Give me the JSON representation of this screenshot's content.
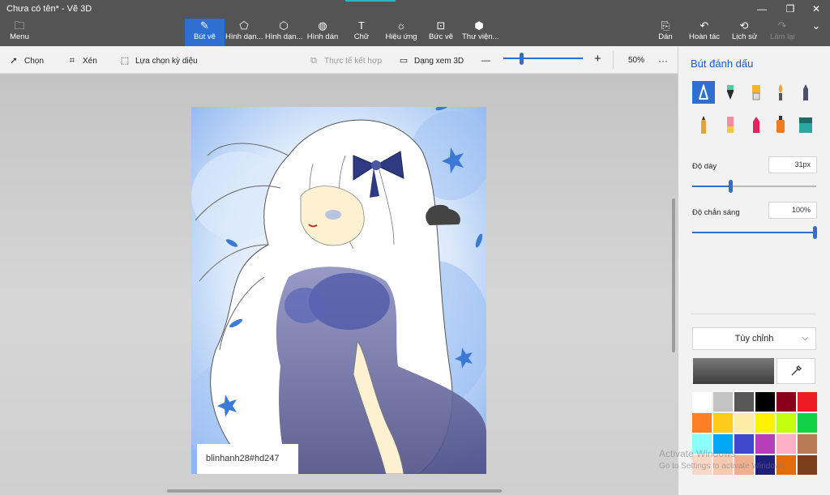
{
  "window": {
    "title": "Chưa có tên* - Vẽ 3D",
    "controls": [
      "—",
      "❐",
      "✕"
    ]
  },
  "ribbon": {
    "menu": "Menu",
    "tabs": [
      {
        "label": "Bút vẽ",
        "icon": "brush-icon",
        "glyph": "✎",
        "active": true
      },
      {
        "label": "Hình dạn...",
        "icon": "shapes-2d-icon",
        "glyph": "⬠",
        "active": false
      },
      {
        "label": "Hình dạn...",
        "icon": "shapes-3d-icon",
        "glyph": "⬡",
        "active": false
      },
      {
        "label": "Hình dán",
        "icon": "sticker-icon",
        "glyph": "◍",
        "active": false
      },
      {
        "label": "Chữ",
        "icon": "text-icon",
        "glyph": "T",
        "active": false
      },
      {
        "label": "Hiệu ứng",
        "icon": "effects-icon",
        "glyph": "☼",
        "active": false
      },
      {
        "label": "Bức vẽ",
        "icon": "canvas-icon",
        "glyph": "⊡",
        "active": false
      },
      {
        "label": "Thư viện...",
        "icon": "library-icon",
        "glyph": "⬢",
        "active": false
      }
    ],
    "right": [
      {
        "label": "Dán",
        "icon": "paste-icon",
        "glyph": "📋"
      },
      {
        "label": "Hoàn tác",
        "icon": "undo-icon",
        "glyph": "↶"
      },
      {
        "label": "Lịch sử",
        "icon": "history-icon",
        "glyph": "⟲"
      },
      {
        "label": "Làm lại",
        "icon": "redo-icon",
        "glyph": "↷"
      }
    ]
  },
  "toolbar": {
    "select": "Chọn",
    "crop": "Xén",
    "magic_select": "Lựa chọn kỳ diệu",
    "mixed_reality": "Thực tế kết hợp",
    "view_3d": "Dạng xem 3D",
    "zoom_out": "—",
    "zoom_in": "+",
    "zoom_percent": "50%",
    "zoom_level": 0.2,
    "more": "···"
  },
  "canvas": {
    "signature": "blinhanh28#hd247"
  },
  "panel": {
    "title": "Bút đánh dấu",
    "brushes": [
      "marker",
      "calligraphy-pen",
      "oil-brush",
      "watercolor",
      "pencil",
      "crayon",
      "eraser",
      "pixel-pen",
      "spray-can",
      "fill"
    ],
    "selected_brush": "marker",
    "thickness_label": "Độ dày",
    "thickness_value": "31px",
    "thickness_level": 0.31,
    "opacity_label": "Độ chắn sáng",
    "opacity_value": "100%",
    "opacity_level": 1.0,
    "finish_select": "Tùy chỉnh",
    "current_color": "#4a4a4a",
    "palette": [
      "#ffffff",
      "#c3c3c3",
      "#585858",
      "#000000",
      "#88001b",
      "#ec1c24",
      "#ff7f27",
      "#ffca18",
      "#fdeca6",
      "#fff200",
      "#c4ff0e",
      "#0ed145",
      "#8cfffb",
      "#00a8f3",
      "#3f48cc",
      "#b83dba",
      "#ffaec8",
      "#b97a56",
      "#f9d8c8",
      "#f6c9b1",
      "#f0b08f",
      "#1f1f7a",
      "#e36c0a",
      "#7a3f1d"
    ],
    "selected_swatch": 2
  },
  "watermark": {
    "line1": "Activate Windows",
    "line2": "Go to Settings to activate Windows."
  }
}
